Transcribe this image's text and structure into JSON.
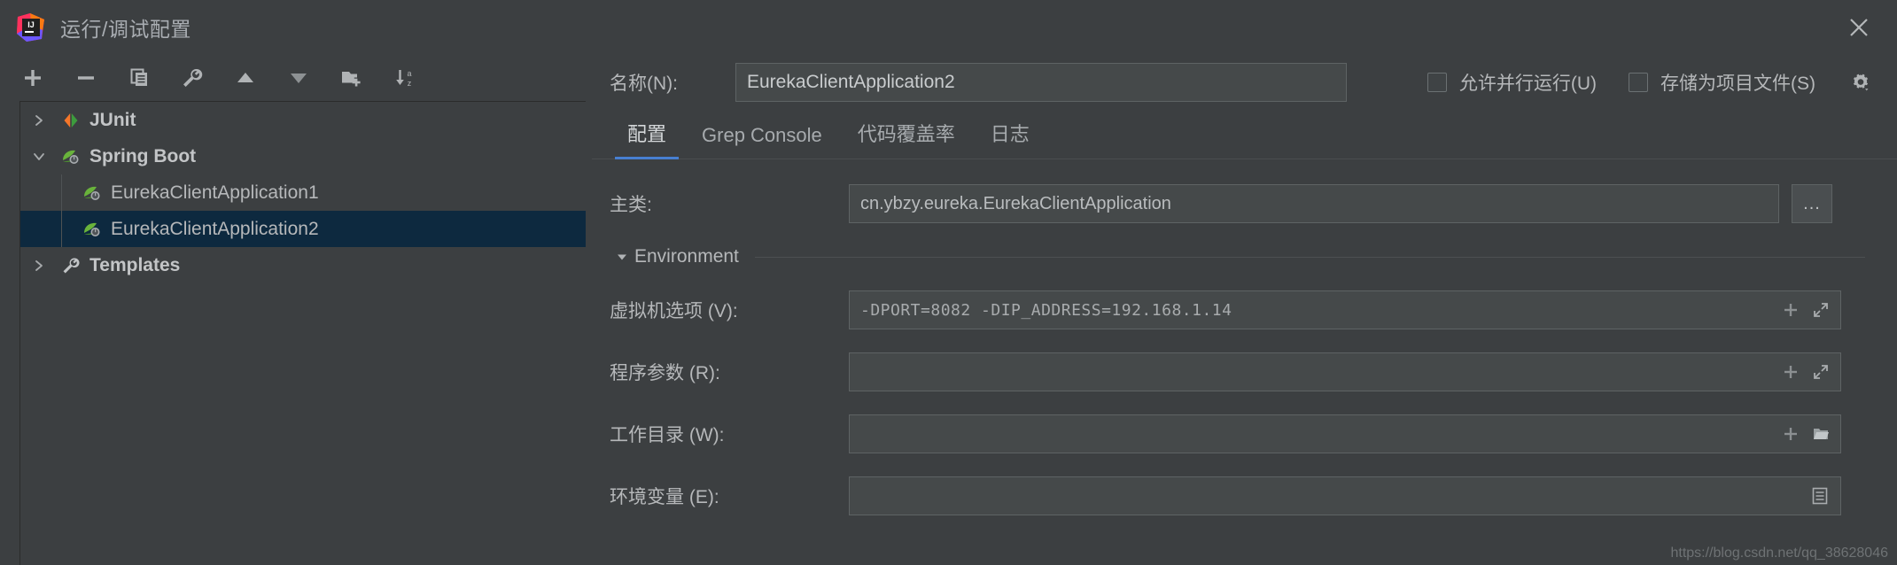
{
  "window": {
    "title": "运行/调试配置",
    "logo_icon": "intellij-idea-logo",
    "close_icon": "close-icon"
  },
  "toolbar": {
    "buttons": [
      {
        "name": "add",
        "icon": "plus-icon"
      },
      {
        "name": "remove",
        "icon": "minus-icon"
      },
      {
        "name": "copy",
        "icon": "copy-icon"
      },
      {
        "name": "edit-templates",
        "icon": "wrench-icon"
      },
      {
        "name": "move-up",
        "icon": "arrow-up-icon"
      },
      {
        "name": "move-down",
        "icon": "arrow-down-icon"
      },
      {
        "name": "new-folder",
        "icon": "folder-plus-icon"
      },
      {
        "name": "sort-alphabetically",
        "icon": "sort-az-icon"
      }
    ]
  },
  "tree": {
    "items": [
      {
        "label": "JUnit",
        "icon": "junit-icon",
        "twisty": "collapsed",
        "level": 0,
        "bold": true,
        "selected": false
      },
      {
        "label": "Spring Boot",
        "icon": "spring-boot-icon",
        "twisty": "expanded",
        "level": 0,
        "bold": true,
        "selected": false
      },
      {
        "label": "EurekaClientApplication1",
        "icon": "spring-boot-icon",
        "twisty": "none",
        "level": 1,
        "bold": false,
        "selected": false
      },
      {
        "label": "EurekaClientApplication2",
        "icon": "spring-boot-icon",
        "twisty": "none",
        "level": 1,
        "bold": false,
        "selected": true
      },
      {
        "label": "Templates",
        "icon": "wrench-icon",
        "twisty": "collapsed",
        "level": 0,
        "bold": true,
        "selected": false
      }
    ]
  },
  "config": {
    "name_label": "名称(N):",
    "name_value": "EurekaClientApplication2",
    "name_placeholder": "",
    "checkboxes": [
      {
        "label": "允许并行运行(U)",
        "checked": false,
        "name": "allow-parallel-run"
      },
      {
        "label": "存储为项目文件(S)",
        "checked": false,
        "name": "store-as-project-file"
      }
    ],
    "gear_icon": "gear-dropdown-icon",
    "tabs": [
      {
        "label": "配置",
        "active": true
      },
      {
        "label": "Grep Console",
        "active": false
      },
      {
        "label": "代码覆盖率",
        "active": false
      },
      {
        "label": "日志",
        "active": false
      }
    ],
    "main_class": {
      "label": "主类:",
      "value": "cn.ybzy.eureka.EurekaClientApplication",
      "browse_label": "..."
    },
    "environment": {
      "title": "Environment",
      "expanded": true,
      "fields": [
        {
          "label": "虚拟机选项 (V):",
          "value": "-DPORT=8082 -DIP_ADDRESS=192.168.1.14",
          "mono": true,
          "name": "vm-options-field",
          "icons": [
            "plus-icon",
            "expand-icon"
          ]
        },
        {
          "label": "程序参数 (R):",
          "value": "",
          "mono": false,
          "name": "program-arguments-field",
          "icons": [
            "plus-icon",
            "expand-icon"
          ]
        },
        {
          "label": "工作目录 (W):",
          "value": "",
          "mono": false,
          "name": "working-directory-field",
          "icons": [
            "plus-icon",
            "folder-icon"
          ]
        },
        {
          "label": "环境变量 (E):",
          "value": "",
          "mono": false,
          "name": "environment-variables-field",
          "icons": [
            "list-icon"
          ]
        }
      ]
    }
  },
  "watermark": "https://blog.csdn.net/qq_38628046",
  "colors": {
    "background": "#3c3f41",
    "selection": "#0d293f",
    "accent": "#477fd1",
    "field_background": "#45494a",
    "text": "#b6b8ba"
  }
}
